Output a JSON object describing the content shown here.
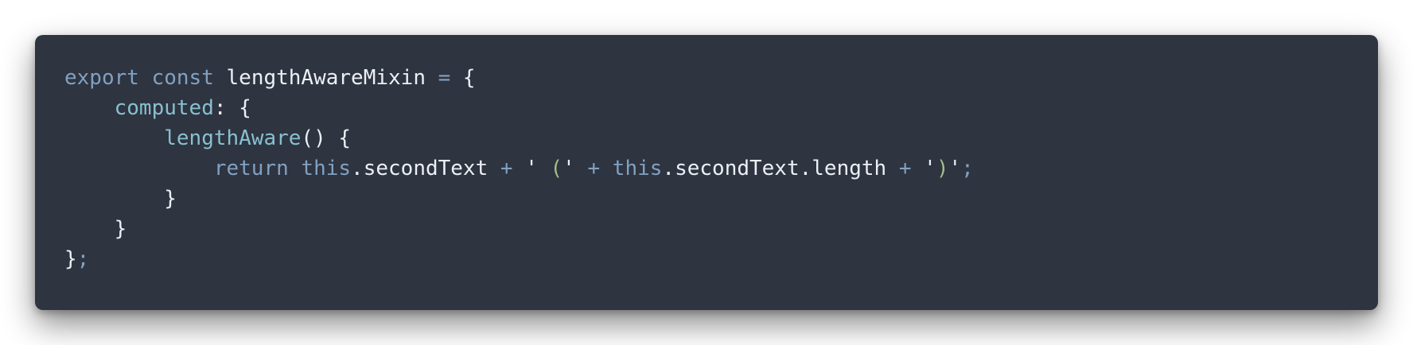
{
  "code_block": {
    "colors": {
      "background": "#2e3440",
      "keyword": "#81a1c1",
      "function": "#88c0d0",
      "text": "#eceff4",
      "string_paren": "#a3be8c"
    },
    "lines": [
      [
        {
          "t": "export",
          "c": "kw"
        },
        {
          "t": " ",
          "c": "pu"
        },
        {
          "t": "const",
          "c": "kw"
        },
        {
          "t": " lengthAwareMixin ",
          "c": "pu"
        },
        {
          "t": "=",
          "c": "op"
        },
        {
          "t": " {",
          "c": "pu"
        }
      ],
      [
        {
          "t": "    ",
          "c": "pu"
        },
        {
          "t": "computed",
          "c": "fn"
        },
        {
          "t": ": {",
          "c": "pu"
        }
      ],
      [
        {
          "t": "        ",
          "c": "pu"
        },
        {
          "t": "lengthAware",
          "c": "fn"
        },
        {
          "t": "() {",
          "c": "pu"
        }
      ],
      [
        {
          "t": "            ",
          "c": "pu"
        },
        {
          "t": "return",
          "c": "kw"
        },
        {
          "t": " ",
          "c": "pu"
        },
        {
          "t": "this",
          "c": "kw"
        },
        {
          "t": ".secondText ",
          "c": "pu"
        },
        {
          "t": "+",
          "c": "op"
        },
        {
          "t": " ' ",
          "c": "str"
        },
        {
          "t": "(",
          "c": "strp"
        },
        {
          "t": "' ",
          "c": "str"
        },
        {
          "t": "+",
          "c": "op"
        },
        {
          "t": " ",
          "c": "pu"
        },
        {
          "t": "this",
          "c": "kw"
        },
        {
          "t": ".secondText.length ",
          "c": "pu"
        },
        {
          "t": "+",
          "c": "op"
        },
        {
          "t": " '",
          "c": "str"
        },
        {
          "t": ")",
          "c": "strp"
        },
        {
          "t": "'",
          "c": "str"
        },
        {
          "t": ";",
          "c": "semi"
        }
      ],
      [
        {
          "t": "        }",
          "c": "pu"
        }
      ],
      [
        {
          "t": "    }",
          "c": "pu"
        }
      ],
      [
        {
          "t": "}",
          "c": "pu"
        },
        {
          "t": ";",
          "c": "semi"
        }
      ]
    ]
  }
}
